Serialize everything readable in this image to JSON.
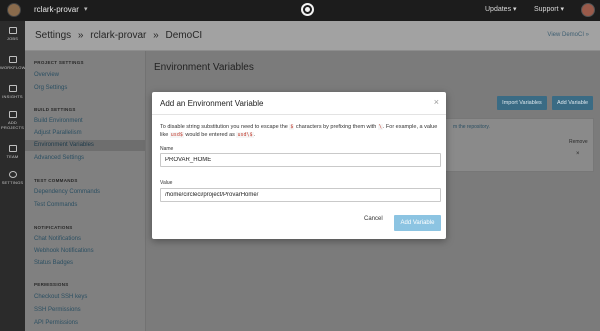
{
  "topbar": {
    "org_name": "rclark-provar",
    "caret": "▾",
    "updates": "Updates ▾",
    "support": "Support ▾"
  },
  "leftnav": [
    {
      "label": "JOBS",
      "icon": "jobs-icon"
    },
    {
      "label": "WORKFLOWS",
      "icon": "workflows-icon"
    },
    {
      "label": "INSIGHTS",
      "icon": "insights-icon"
    },
    {
      "label": "ADD PROJECTS",
      "icon": "add-projects-icon"
    },
    {
      "label": "TEAM",
      "icon": "team-icon"
    },
    {
      "label": "SETTINGS",
      "icon": "settings-icon"
    }
  ],
  "header": {
    "crumbs": [
      "Settings",
      "»",
      "rclark-provar",
      "»",
      "DemoCI"
    ],
    "view_link": "View DemoCI »"
  },
  "sidebar": {
    "sections": [
      {
        "title": "PROJECT SETTINGS",
        "items": [
          "Overview",
          "Org Settings"
        ]
      },
      {
        "title": "BUILD SETTINGS",
        "items": [
          "Build Environment",
          "Adjust Parallelism",
          "Environment Variables",
          "Advanced Settings"
        ]
      },
      {
        "title": "TEST COMMANDS",
        "items": [
          "Dependency Commands",
          "Test Commands"
        ]
      },
      {
        "title": "NOTIFICATIONS",
        "items": [
          "Chat Notifications",
          "Webhook Notifications",
          "Status Badges"
        ]
      },
      {
        "title": "PERMISSIONS",
        "items": [
          "Checkout SSH keys",
          "SSH Permissions",
          "API Permissions"
        ]
      }
    ],
    "active_item": "Environment Variables"
  },
  "main": {
    "title": "Environment Variables",
    "import_button": "Import Variables",
    "add_button": "Add Variable",
    "repo_text": "m the repository.",
    "remove_header": "Remove",
    "remove_icon": "×"
  },
  "modal": {
    "title": "Add an Environment Variable",
    "close": "×",
    "desc_part1": "To disable string substitution you need to escape the",
    "code1": "$",
    "desc_part2": "characters by prefixing them with",
    "code2": "\\",
    "desc_part3": ". For example, a value like",
    "code3": "usd$",
    "desc_part4": "would be entered as",
    "code4": "usd\\$",
    "desc_part5": ".",
    "name_label": "Name",
    "name_value": "PROVAR_HOME",
    "value_label": "Value",
    "value_value": "/home/circleci/project/ProvarHome/",
    "cancel_button": "Cancel",
    "add_button": "Add Variable"
  },
  "colors": {
    "primary_button": "#8cc4e2",
    "link": "#2b4f62",
    "code": "#c0392b"
  }
}
